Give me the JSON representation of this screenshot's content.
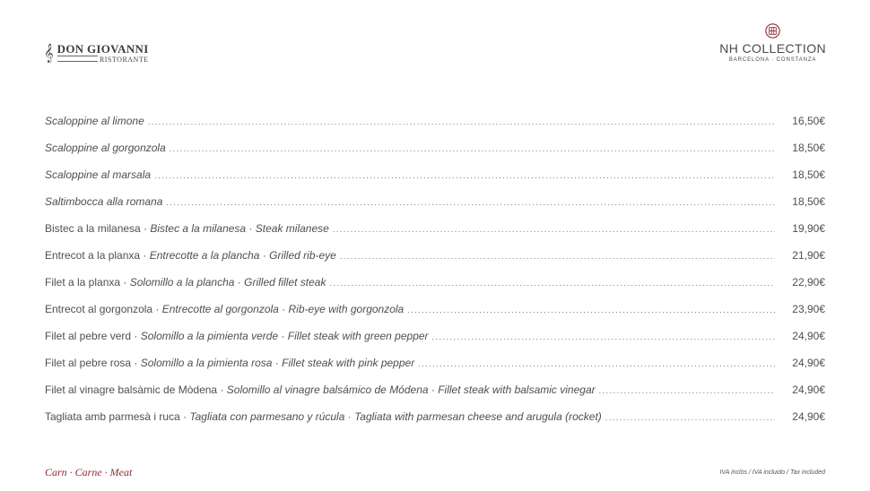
{
  "header": {
    "left_logo": {
      "name": "DON GIOVANNI",
      "sub": "RISTORANTE",
      "icon": "treble-clef-icon"
    },
    "right_logo": {
      "brand_prefix": "NH",
      "brand_name": "COLLECTION",
      "location": "BARCELONA · CONSTANZA",
      "icon": "nh-emblem-icon",
      "accent": "#8a2a32"
    }
  },
  "menu": {
    "items": [
      {
        "parts": [
          {
            "text": "Scaloppine al limone",
            "italic": true
          }
        ],
        "price": "16,50€"
      },
      {
        "parts": [
          {
            "text": "Scaloppine al gorgonzola",
            "italic": true
          }
        ],
        "price": "18,50€"
      },
      {
        "parts": [
          {
            "text": "Scaloppine al marsala",
            "italic": true
          }
        ],
        "price": "18,50€"
      },
      {
        "parts": [
          {
            "text": "Saltimbocca alla romana",
            "italic": true
          }
        ],
        "price": "18,50€"
      },
      {
        "parts": [
          {
            "text": "Bistec a la milanesa · ",
            "italic": false
          },
          {
            "text": "Bistec a la milanesa · Steak milanese",
            "italic": true
          }
        ],
        "price": "19,90€"
      },
      {
        "parts": [
          {
            "text": "Entrecot a la planxa · ",
            "italic": false
          },
          {
            "text": "Entrecotte a la plancha · Grilled rib-eye",
            "italic": true
          }
        ],
        "price": "21,90€"
      },
      {
        "parts": [
          {
            "text": "Filet a la planxa · ",
            "italic": false
          },
          {
            "text": "Solomillo a la plancha · Grilled fillet steak",
            "italic": true
          }
        ],
        "price": "22,90€"
      },
      {
        "parts": [
          {
            "text": "Entrecot al gorgonzola · ",
            "italic": false
          },
          {
            "text": "Entrecotte al gorgonzola · Rib-eye with gorgonzola",
            "italic": true
          }
        ],
        "price": "23,90€"
      },
      {
        "parts": [
          {
            "text": "Filet al pebre verd · ",
            "italic": false
          },
          {
            "text": "Solomillo a la pimienta verde · Fillet steak with green pepper",
            "italic": true
          }
        ],
        "price": "24,90€"
      },
      {
        "parts": [
          {
            "text": "Filet al pebre rosa · ",
            "italic": false
          },
          {
            "text": "Solomillo a la pimienta rosa · Fillet steak with pink pepper",
            "italic": true
          }
        ],
        "price": "24,90€"
      },
      {
        "parts": [
          {
            "text": "Filet al vinagre balsàmic de Mòdena · ",
            "italic": false
          },
          {
            "text": "Solomillo al vinagre balsámico de Módena · Fillet steak with balsamic vinegar",
            "italic": true
          }
        ],
        "price": "24,90€"
      },
      {
        "parts": [
          {
            "text": "Tagliata amb parmesà i ruca · ",
            "italic": false
          },
          {
            "text": "Tagliata con parmesano y rúcula · Tagliata with parmesan cheese and arugula (rocket)",
            "italic": true
          }
        ],
        "price": "24,90€"
      }
    ]
  },
  "footer": {
    "section_title": "Carn · Carne · Meat",
    "tax_note": "IVA inclòs / IVA incluido / Tax included"
  }
}
